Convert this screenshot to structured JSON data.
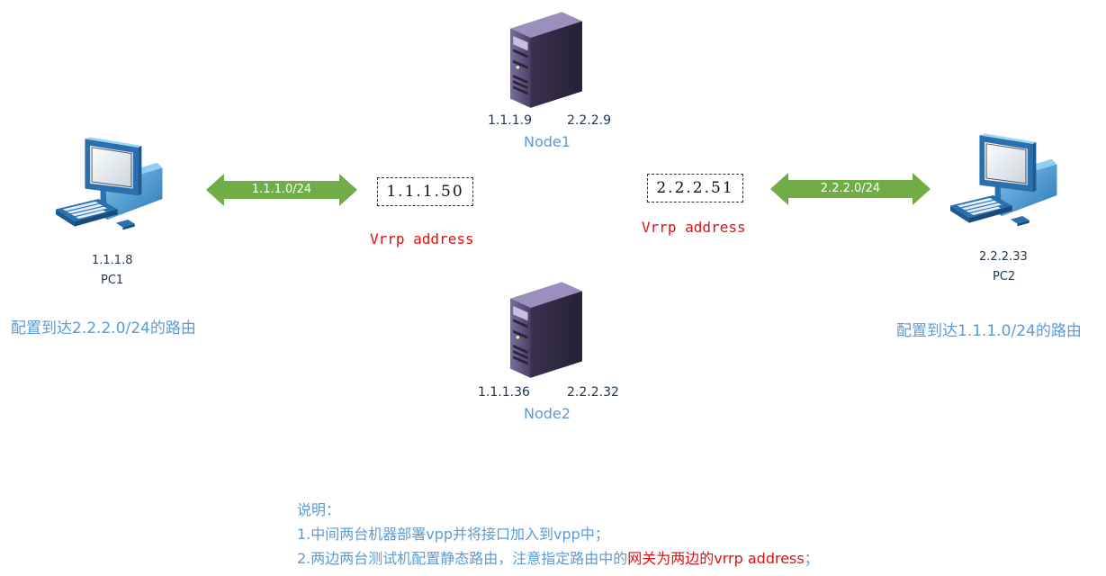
{
  "node1": {
    "name": "Node1",
    "ip_left": "1.1.1.9",
    "ip_right": "2.2.2.9",
    "icon": "server-icon"
  },
  "node2": {
    "name": "Node2",
    "ip_left": "1.1.1.36",
    "ip_right": "2.2.2.32",
    "icon": "server-icon"
  },
  "pc1": {
    "name": "PC1",
    "ip": "1.1.1.8",
    "icon": "desktop-computer-icon",
    "route_note": "配置到达2.2.2.0/24的路由"
  },
  "pc2": {
    "name": "PC2",
    "ip": "2.2.2.33",
    "icon": "desktop-computer-icon",
    "route_note": "配置到达1.1.1.0/24的路由"
  },
  "vip_left": {
    "address": "1.1.1.50",
    "label": "Vrrp address"
  },
  "vip_right": {
    "address": "2.2.2.51",
    "label": "Vrrp address"
  },
  "link_left": {
    "label": "1.1.1.0/24"
  },
  "link_right": {
    "label": "2.2.2.0/24"
  },
  "notes": {
    "title": "说明：",
    "line1": "1.中间两台机器部署vpp并将接口加入到vpp中；",
    "line2_prefix": "2.两边两台测试机配置静态路由，注意指定路由中的",
    "line2_highlight": "网关为两边的vrrp address",
    "line2_suffix": "；"
  },
  "colors": {
    "text_blue": "#5b9bd5",
    "text_dark": "#1f3550",
    "vrrp_red": "#e01010",
    "arrow_green": "#70ad47",
    "server_purple": "#5c4f7c"
  }
}
